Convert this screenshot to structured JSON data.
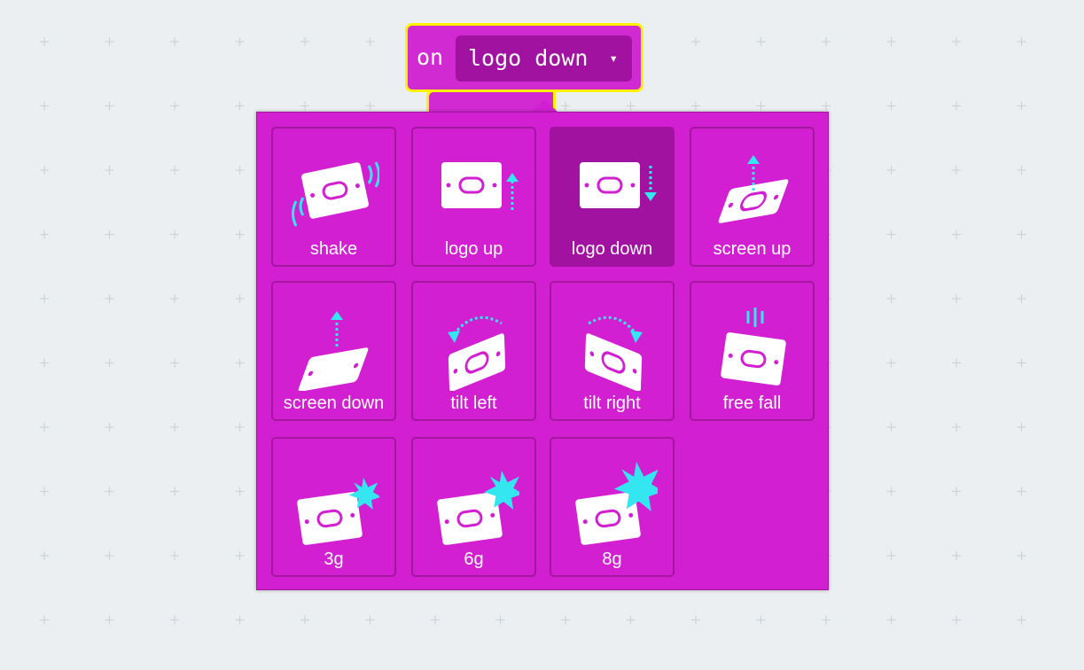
{
  "block": {
    "prefix": "on",
    "field_value": "logo down",
    "caret": "▾",
    "color": "#D22AD2",
    "highlight_color": "#FFF200"
  },
  "dropdown": {
    "selected": "logo down",
    "accent_color": "#33E6F0",
    "items": [
      {
        "label": "shake",
        "icon": "shake-icon"
      },
      {
        "label": "logo up",
        "icon": "logo-up-icon"
      },
      {
        "label": "logo down",
        "icon": "logo-down-icon"
      },
      {
        "label": "screen up",
        "icon": "screen-up-icon"
      },
      {
        "label": "screen down",
        "icon": "screen-down-icon"
      },
      {
        "label": "tilt left",
        "icon": "tilt-left-icon"
      },
      {
        "label": "tilt right",
        "icon": "tilt-right-icon"
      },
      {
        "label": "free fall",
        "icon": "free-fall-icon"
      },
      {
        "label": "3g",
        "icon": "3g-icon"
      },
      {
        "label": "6g",
        "icon": "6g-icon"
      },
      {
        "label": "8g",
        "icon": "8g-icon"
      }
    ]
  }
}
